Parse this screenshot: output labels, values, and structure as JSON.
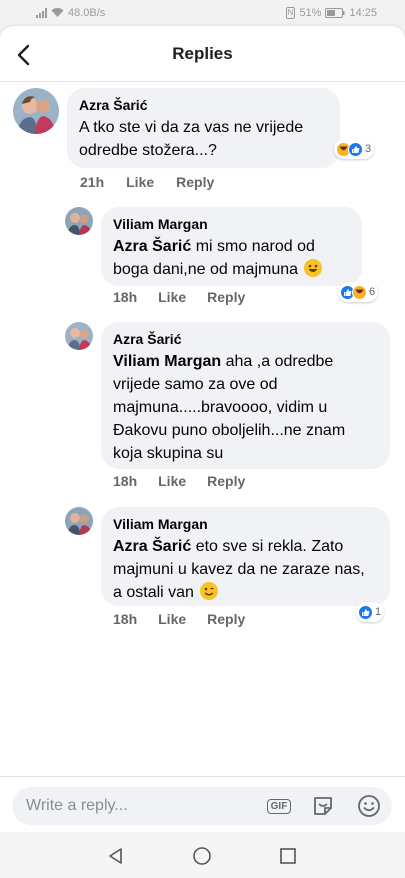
{
  "status": {
    "speed": "48.0B/s",
    "nfc": "N",
    "battery": "51%",
    "time": "14:25"
  },
  "header": {
    "title": "Replies",
    "back_icon": "back-arrow-icon"
  },
  "comments": [
    {
      "author": "Azra Šarić",
      "mention": "",
      "text": "A tko ste vi da za vas ne vrijede odredbe stožera...?",
      "time": "21h",
      "like": "Like",
      "reply": "Reply",
      "reactions": [
        "haha",
        "like"
      ],
      "reaction_count": "3"
    },
    {
      "author": "Viliam Margan",
      "mention": "Azra Šarić",
      "text": " mi smo narod od boga dani,ne od majmuna ",
      "emoji": "grinning",
      "time": "18h",
      "like": "Like",
      "reply": "Reply",
      "reactions": [
        "like",
        "haha"
      ],
      "reaction_count": "6"
    },
    {
      "author": "Azra Šarić",
      "mention": "Viliam Margan",
      "text": " aha ,a odredbe vrijede samo za ove od majmuna.....bravoooo, vidim u Đakovu puno oboljelih...ne znam koja skupina su",
      "time": "18h",
      "like": "Like",
      "reply": "Reply"
    },
    {
      "author": "Viliam Margan",
      "mention": "Azra Šarić",
      "text": " eto sve si rekla. Zato majmuni u kavez da ne zaraze nas, a ostali van ",
      "emoji": "winking",
      "time": "18h",
      "like": "Like",
      "reply": "Reply",
      "reactions": [
        "like"
      ],
      "reaction_count": "1"
    }
  ],
  "composer": {
    "placeholder": "Write a reply...",
    "gif_label": "GIF",
    "sticker_icon": "sticker-icon",
    "emoji_icon": "smiley-icon"
  },
  "colors": {
    "accent": "#1877f2",
    "meta_text": "#65676b",
    "bubble": "#f0f2f5"
  }
}
